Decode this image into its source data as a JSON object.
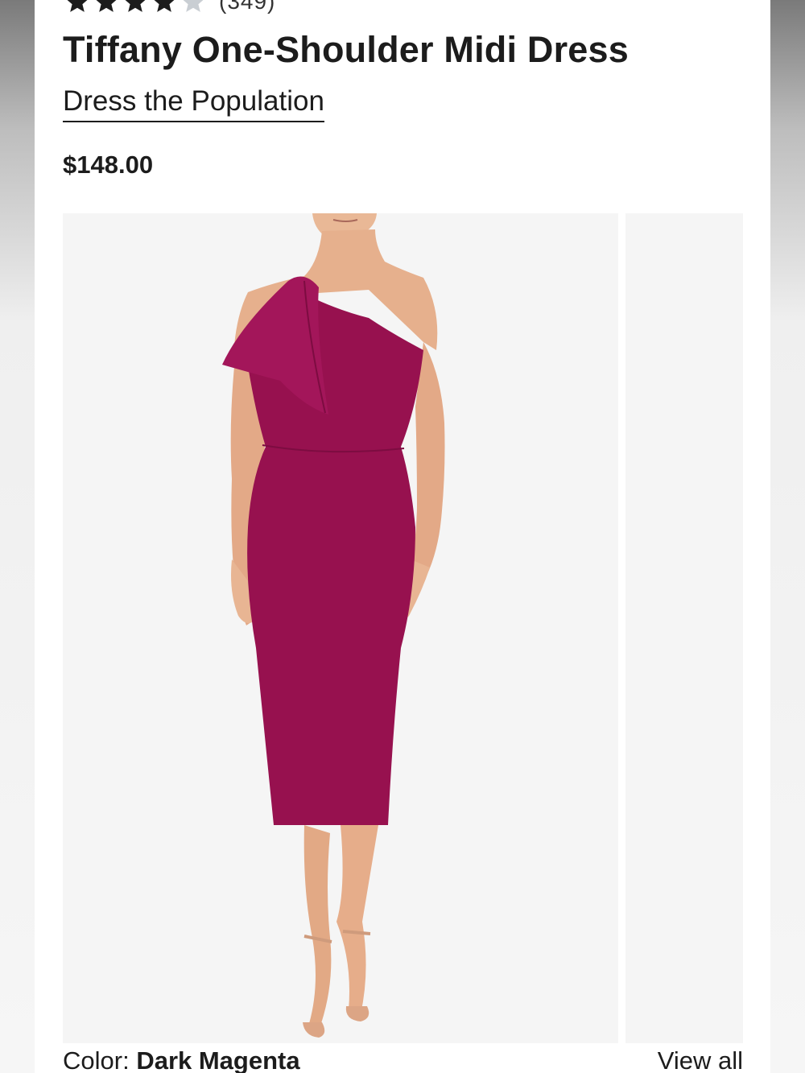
{
  "product": {
    "rating": 4,
    "rating_max": 5,
    "review_count": "(349)",
    "title": "Tiffany One-Shoulder Midi Dress",
    "brand": "Dress the Population",
    "price": "$148.00"
  },
  "gallery": {
    "main_image_icon": "dress-photo-icon",
    "dress_color_hex": "#97114f"
  },
  "color_selector": {
    "label": "Color: ",
    "value": "Dark Magenta",
    "view_all": "View all"
  },
  "colors": {
    "star_filled": "#1c1c1c",
    "star_empty": "#c9ced3",
    "text": "#1c1c1c",
    "image_bg": "#f5f5f5"
  }
}
